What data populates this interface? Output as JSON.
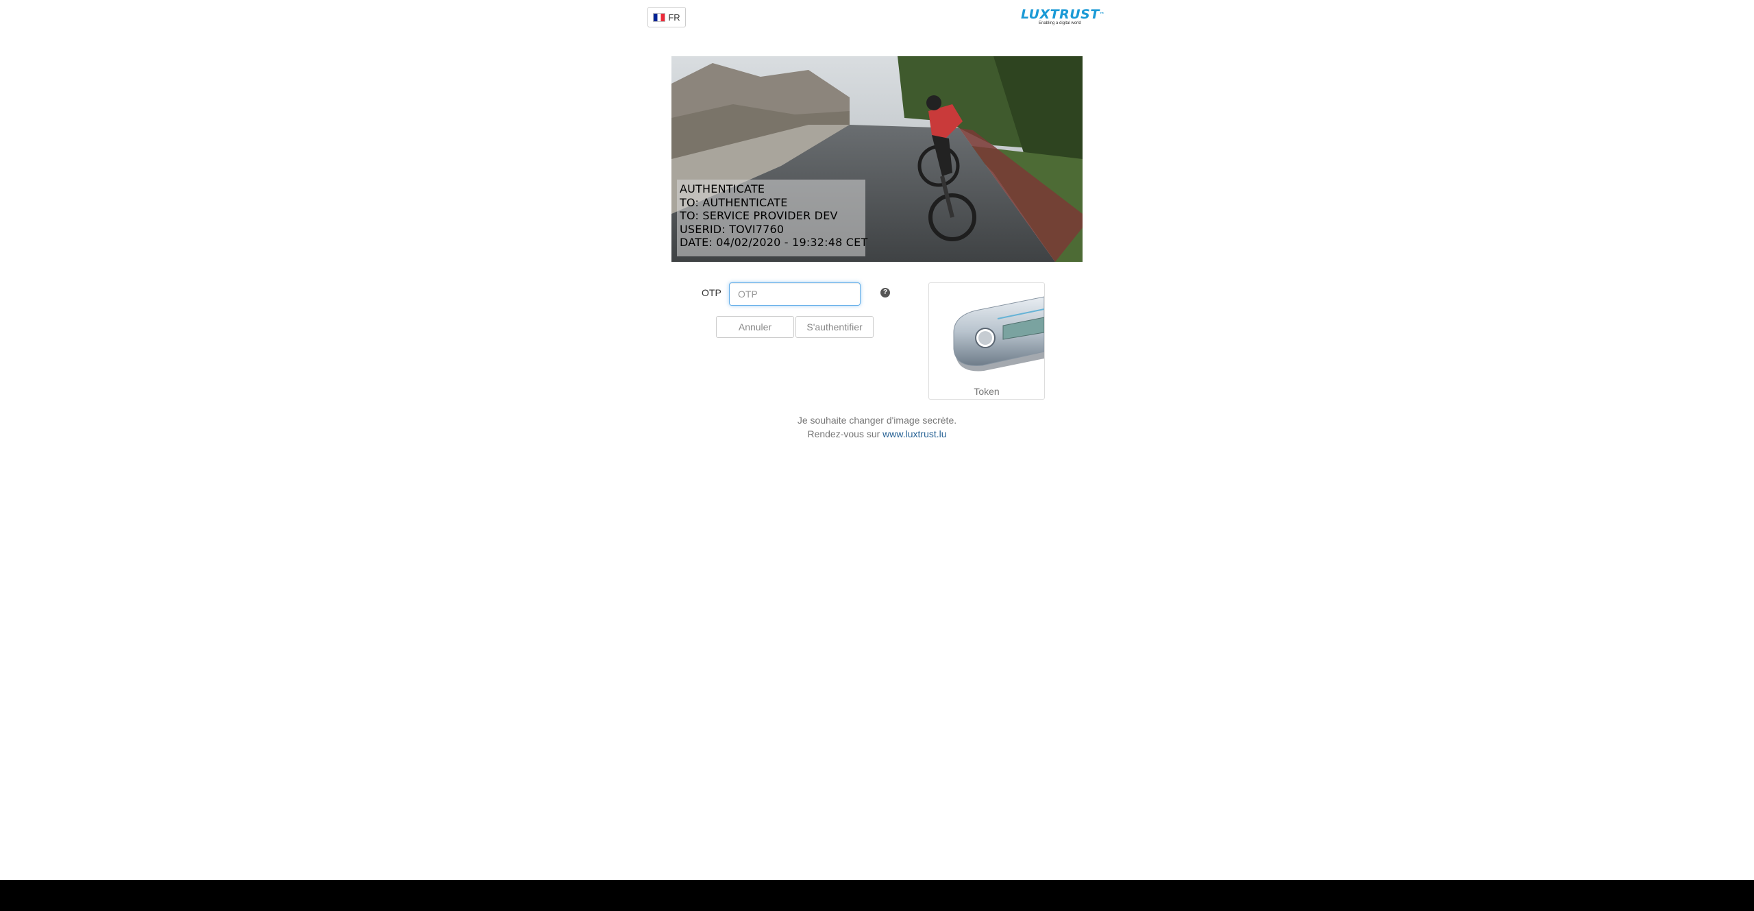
{
  "header": {
    "language_label": "FR",
    "logo": {
      "wordmark": "LUXTRUST",
      "tagline": "Enabling a digital world",
      "brand_color": "#1b9ad6"
    }
  },
  "secret_image": {
    "overlay_lines": [
      "AUTHENTICATE",
      "TO: AUTHENTICATE",
      "TO: SERVICE PROVIDER DEV",
      "USERID: TOVI7760",
      "DATE: 04/02/2020 - 19:32:48 CET"
    ]
  },
  "form": {
    "otp_label": "OTP",
    "otp_placeholder": "OTP",
    "otp_value": "",
    "help_icon": "question-circle-icon",
    "cancel_label": "Annuler",
    "submit_label": "S'authentifier"
  },
  "token_card": {
    "label": "Token"
  },
  "footer": {
    "line1": "Je souhaite changer d'image secrète.",
    "line2_prefix": "Rendez-vous sur ",
    "link_text": "www.luxtrust.lu",
    "link_color": "#2a6496"
  }
}
